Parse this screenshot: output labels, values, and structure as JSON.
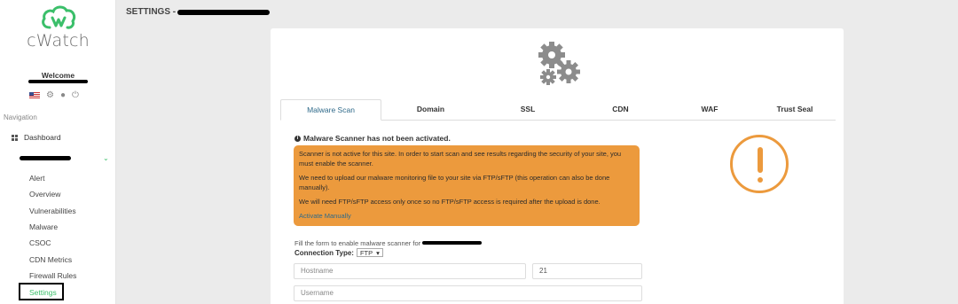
{
  "app": {
    "name": "cWatch"
  },
  "sidebar": {
    "welcome": "Welcome",
    "nav_heading": "Navigation",
    "dashboard": "Dashboard",
    "items": [
      "Alert",
      "Overview",
      "Vulnerabilities",
      "Malware",
      "CSOC",
      "CDN Metrics",
      "Firewall Rules",
      "Settings"
    ],
    "active_item": "Settings"
  },
  "header": {
    "title": "SETTINGS -"
  },
  "tabs": [
    "Malware Scan",
    "Domain",
    "SSL",
    "CDN",
    "WAF",
    "Trust Seal"
  ],
  "active_tab": "Malware Scan",
  "malware": {
    "status_title": "Malware Scanner has not been activated.",
    "alert_p1": "Scanner is not active for this site. In order to start scan and see results regarding the security of your site, you must enable the scanner.",
    "alert_p2": "We need to upload our malware monitoring file to your site via FTP/sFTP (this operation can also be done manually).",
    "alert_p3": "We will need FTP/sFTP access only once so no FTP/sFTP access is required after the upload is done.",
    "activate_link": "Activate Manually",
    "form_note": "Fill the form to enable malware scanner for",
    "connection_type_label": "Connection Type:",
    "connection_type_value": "FTP",
    "hostname_placeholder": "Hostname",
    "port_value": "21",
    "username_placeholder": "Username"
  },
  "colors": {
    "accent": "#3bbf6a",
    "warning": "#ec9a3d",
    "link": "#2f6a8a"
  }
}
